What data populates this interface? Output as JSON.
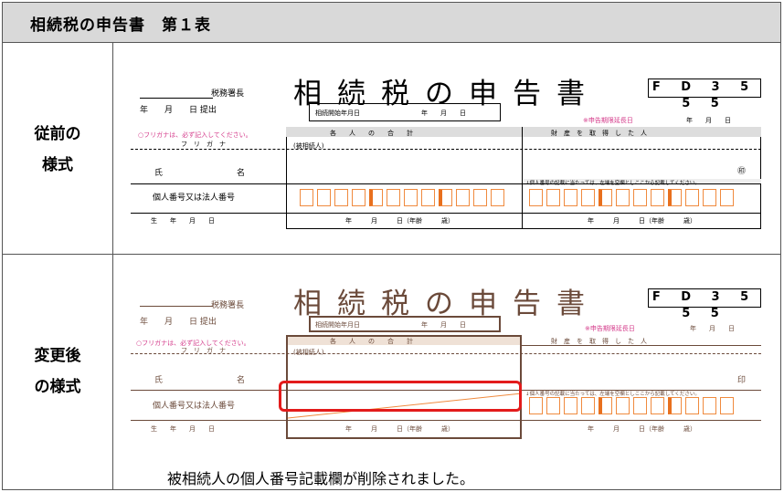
{
  "header": {
    "title": "相続税の申告書　第１表"
  },
  "rows": {
    "before": {
      "label_line1": "従前の",
      "label_line2": "様式"
    },
    "after": {
      "label_line1": "変更後",
      "label_line2": "の様式"
    }
  },
  "form": {
    "office_head": "税務署長",
    "submitted": "年　　月　　日 提出",
    "main_title": "相続税の申告書",
    "form_code": "F D 3 5 5 5",
    "start_date_label": "相続開始年月日",
    "start_date_suffix": "年　　月　　日",
    "extension_label": "※申告期限延長日",
    "extension_date": "年　　月　　日",
    "furigana_note": "○フリガナは、必ず記入してください。",
    "col_each_person": "各　　人　　の　　合　　計",
    "col_heir": "財　産　を　取　得　し　た　人",
    "furigana": "フ　リ　ガ　ナ",
    "deceased": "(被相続人)",
    "name_label": "氏　　　　　　　　　名",
    "seal": "㊞",
    "seal_after": "印",
    "my_number_label": "個人番号又は法人番号",
    "my_number_note": "↓個人番号の記載に当たっては、左端を空欄としここから記載してください。",
    "birth_left": "生　　年　　月　　日",
    "birth_right": "年　　　月　　　日（年齢　　　歳）"
  },
  "note": "被相続人の個人番号記載欄が削除されました。"
}
